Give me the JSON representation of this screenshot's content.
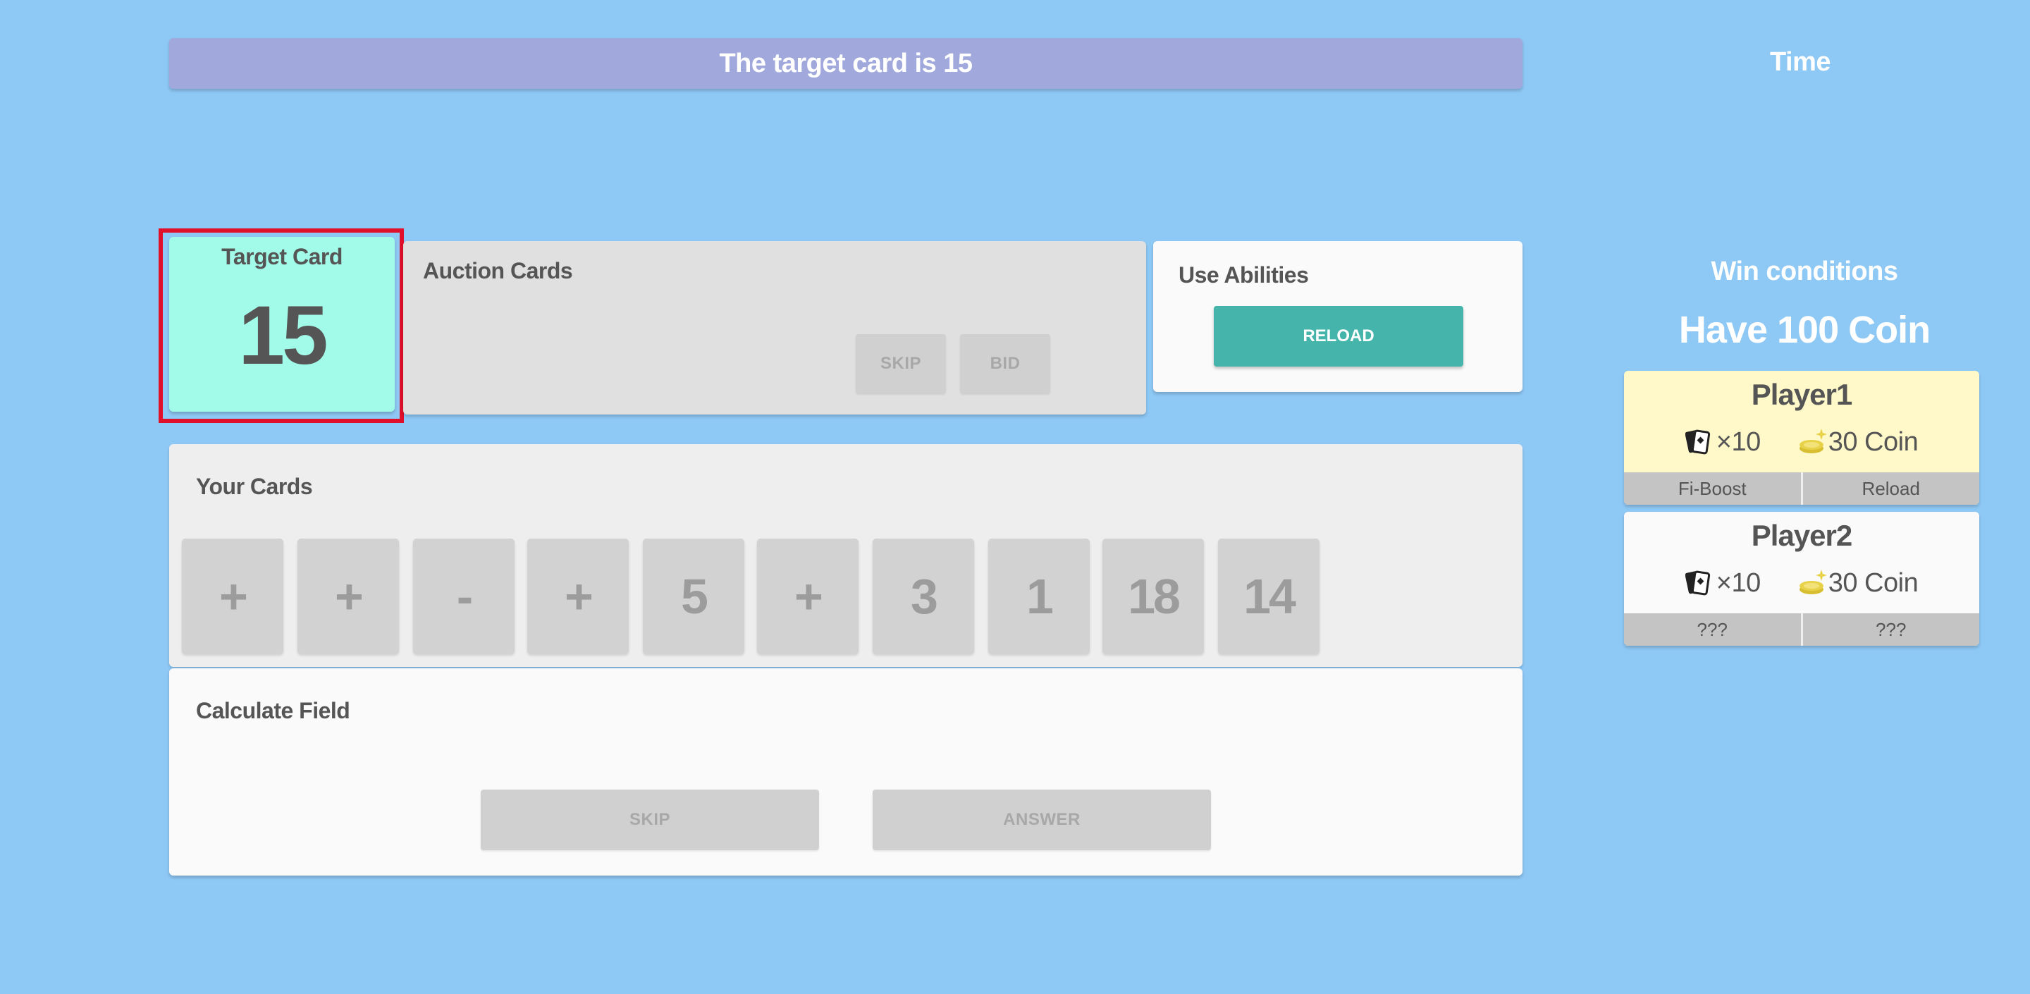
{
  "header": {
    "message": "The target card is 15",
    "time_label": "Time"
  },
  "target_card": {
    "label": "Target Card",
    "value": "15"
  },
  "auction": {
    "title": "Auction Cards",
    "skip_label": "SKIP",
    "bid_label": "BID"
  },
  "abilities": {
    "title": "Use Abilities",
    "reload_label": "RELOAD"
  },
  "hand": {
    "title": "Your Cards",
    "cards": [
      "+",
      "+",
      "-",
      "+",
      "5",
      "+",
      "3",
      "1",
      "18",
      "14"
    ]
  },
  "calculate": {
    "title": "Calculate Field",
    "skip_label": "SKIP",
    "answer_label": "ANSWER"
  },
  "win_conditions": {
    "title": "Win conditions",
    "value": "Have 100 Coin"
  },
  "players": [
    {
      "name": "Player1",
      "cards": "×10",
      "coins": "30 Coin",
      "abilities": [
        "Fi-Boost",
        "Reload"
      ]
    },
    {
      "name": "Player2",
      "cards": "×10",
      "coins": "30 Coin",
      "abilities": [
        "???",
        "???"
      ]
    }
  ],
  "colors": {
    "background": "#8ec8f5",
    "header": "#a0a8dc",
    "target_card": "#a2fbe8",
    "reload_button": "#45b5ab",
    "player1_card": "#fff8c8",
    "highlight": "#e0102a",
    "coin": "#e8d24a"
  },
  "icons": {
    "cards": "cards-icon",
    "coins": "coin-icon"
  }
}
